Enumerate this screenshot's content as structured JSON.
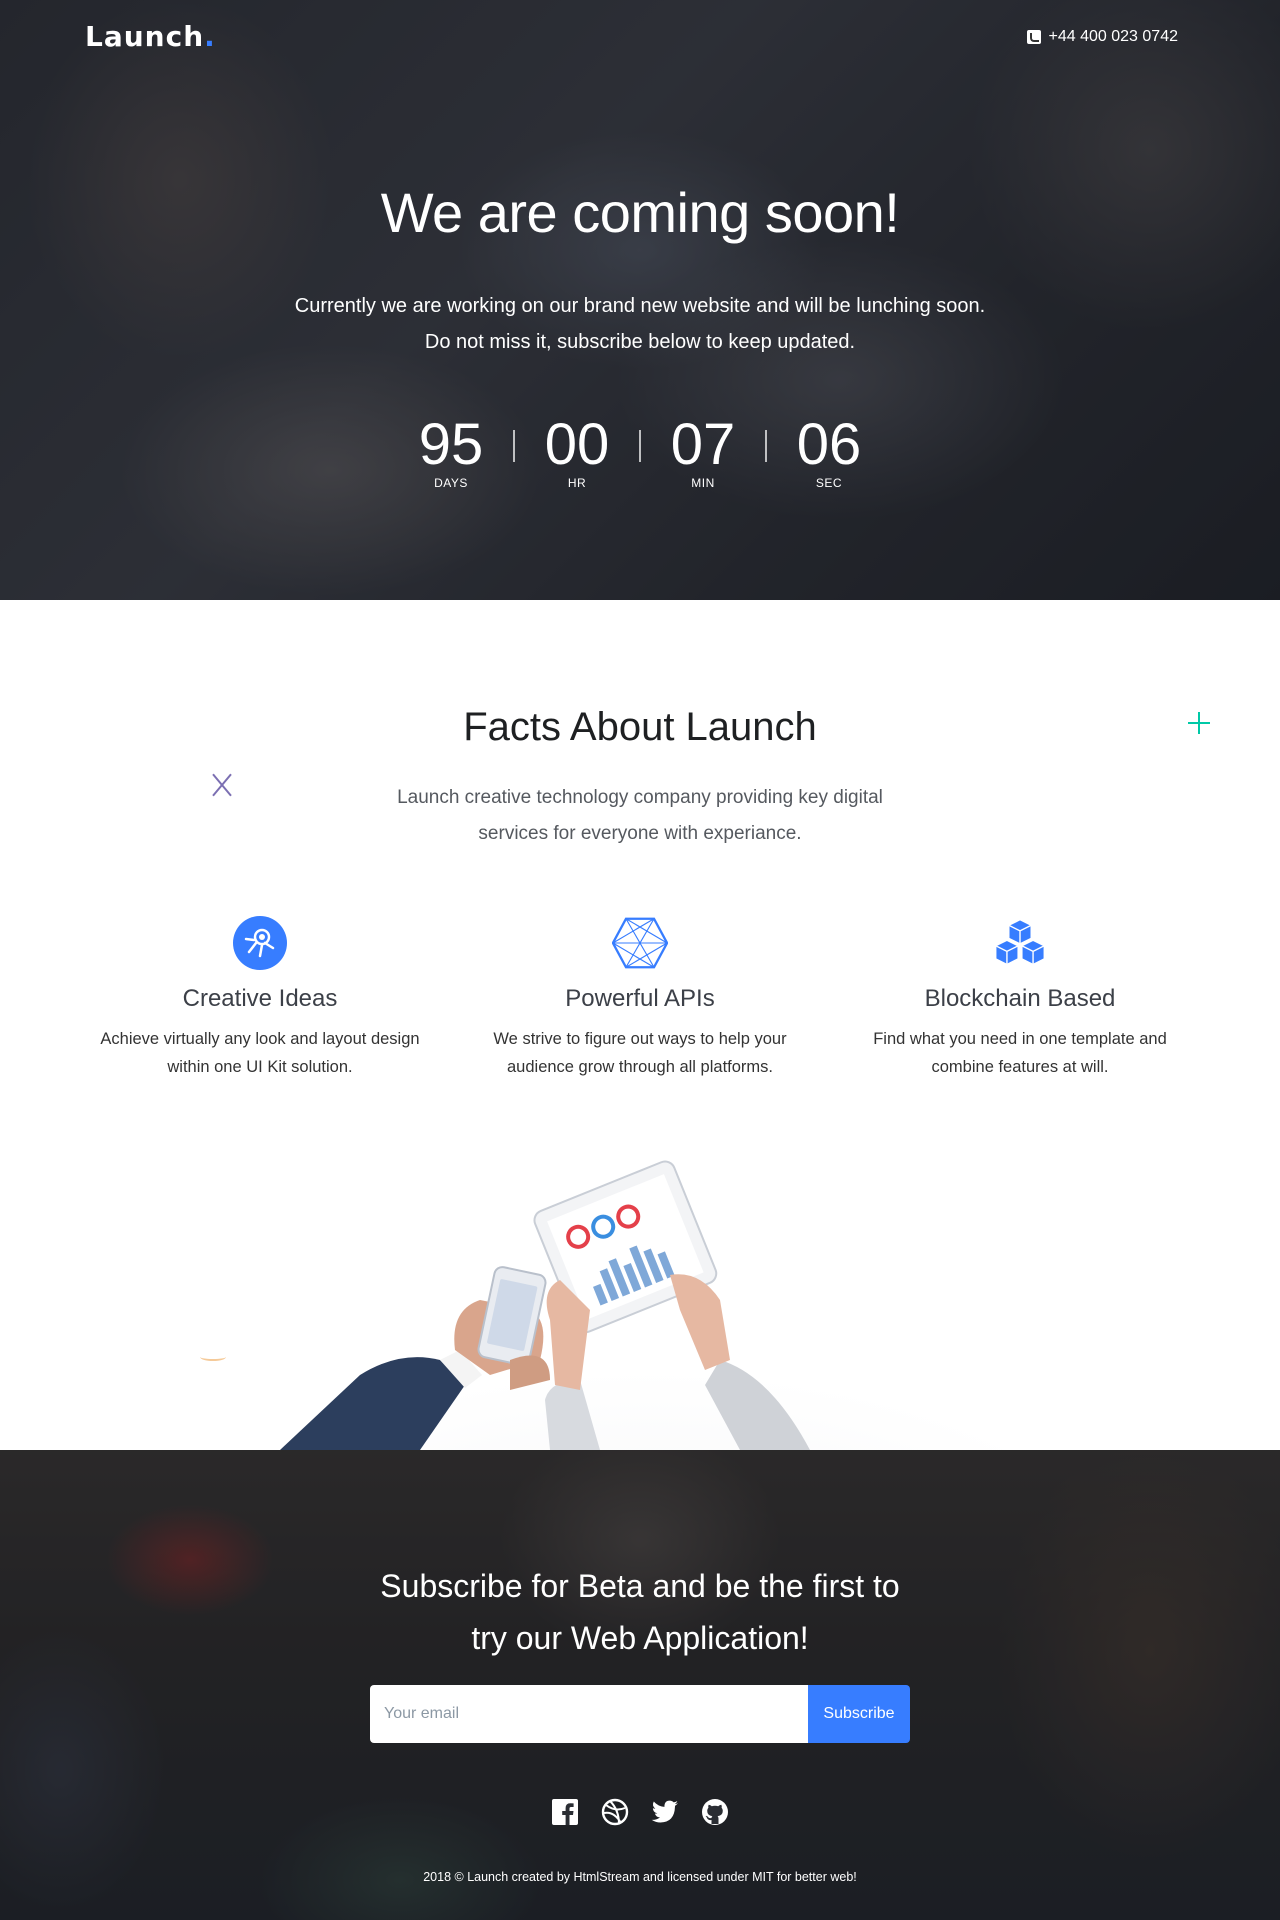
{
  "header": {
    "logo_text": "Launch",
    "logo_dot": ".",
    "phone": "+44 400 023 0742"
  },
  "hero": {
    "title": "We are coming soon!",
    "subtitle_line1": "Currently we are working on our brand new website and will be lunching soon.",
    "subtitle_line2": "Do not miss it, subscribe below to keep updated.",
    "countdown": [
      {
        "value": "95",
        "label": "DAYS"
      },
      {
        "value": "00",
        "label": "HR"
      },
      {
        "value": "07",
        "label": "MIN"
      },
      {
        "value": "06",
        "label": "SEC"
      }
    ]
  },
  "facts": {
    "title": "Facts About Launch",
    "subtitle_line1": "Launch creative technology company providing key digital",
    "subtitle_line2": "services for everyone with experiance.",
    "features": [
      {
        "icon": "astronaut-icon",
        "title": "Creative Ideas",
        "line1": "Achieve virtually any look and layout design",
        "line2": "within one UI Kit solution."
      },
      {
        "icon": "hexagon-network-icon",
        "title": "Powerful APIs",
        "line1": "We strive to figure out ways to help your",
        "line2": "audience grow through all platforms."
      },
      {
        "icon": "blockchain-cubes-icon",
        "title": "Blockchain Based",
        "line1": "Find what you need in one template and",
        "line2": "combine features at will."
      }
    ]
  },
  "subscribe": {
    "title_line1": "Subscribe for Beta and be the first to",
    "title_line2": "try our Web Application!",
    "email_placeholder": "Your email",
    "button_label": "Subscribe",
    "socials": [
      "facebook-icon",
      "dribbble-icon",
      "twitter-icon",
      "github-icon"
    ],
    "copyright": "2018 © Launch created by HtmlStream and licensed under MIT for better web!"
  },
  "colors": {
    "accent": "#377dff",
    "deco_plus": "#00c9a7",
    "deco_x": "#7b6fb2"
  }
}
